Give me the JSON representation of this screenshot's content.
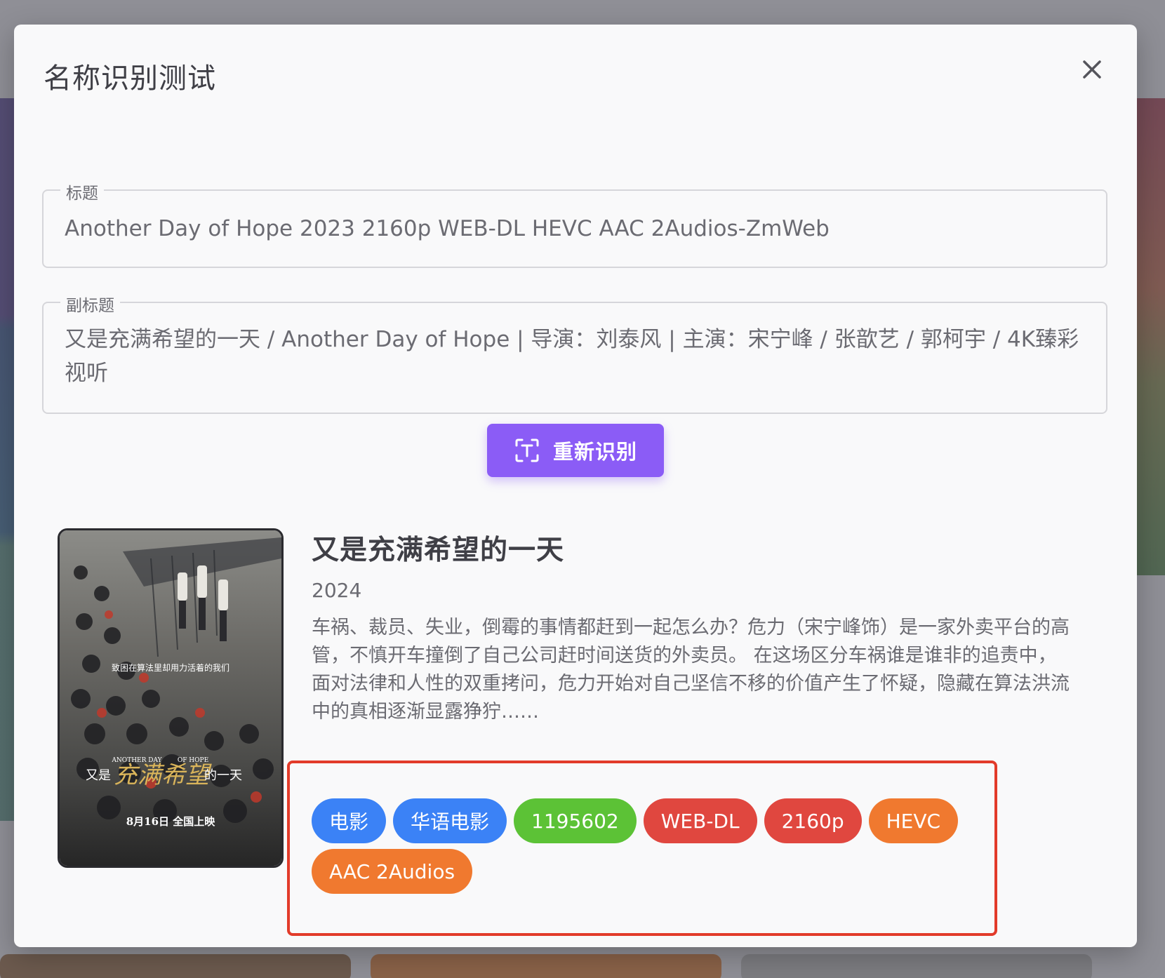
{
  "dialog": {
    "title": "名称识别测试"
  },
  "form": {
    "title_label": "标题",
    "title_value": "Another Day of Hope 2023 2160p WEB-DL HEVC AAC 2Audios-ZmWeb",
    "subtitle_label": "副标题",
    "subtitle_value": "又是充满希望的一天 / Another Day of Hope | 导演：刘泰风 | 主演：宋宁峰 / 张歆艺 / 郭柯宇 / 4K臻彩视听"
  },
  "action": {
    "recognize_label": "重新识别"
  },
  "result": {
    "title": "又是充满希望的一天",
    "year": "2024",
    "overview": "车祸、裁员、失业，倒霉的事情都赶到一起怎么办？危力（宋宁峰饰）是一家外卖平台的高管，不慎开车撞倒了自己公司赶时间送货的外卖员。 在这场区分车祸谁是谁非的追责中，面对法律和人性的双重拷问，危力开始对自己坚信不移的价值产生了怀疑，隐藏在算法洪流中的真相逐渐显露狰狞……",
    "poster_texts": {
      "tagline": "致困在算法里却用力活着的我们",
      "en_title_left": "ANOTHER DAY",
      "en_title_right": "OF HOPE",
      "cn_title_a": "又是",
      "cn_title_b": "充满希望",
      "cn_title_c": "的一天",
      "release": "8月16日 全国上映"
    }
  },
  "tags": [
    {
      "label": "电影",
      "color": "#3b82f6"
    },
    {
      "label": "华语电影",
      "color": "#3b82f6"
    },
    {
      "label": "1195602",
      "color": "#5cc236"
    },
    {
      "label": "WEB-DL",
      "color": "#e0473f"
    },
    {
      "label": "2160p",
      "color": "#e0473f"
    },
    {
      "label": "HEVC",
      "color": "#f0792f"
    },
    {
      "label": "AAC 2Audios",
      "color": "#f0792f"
    }
  ]
}
